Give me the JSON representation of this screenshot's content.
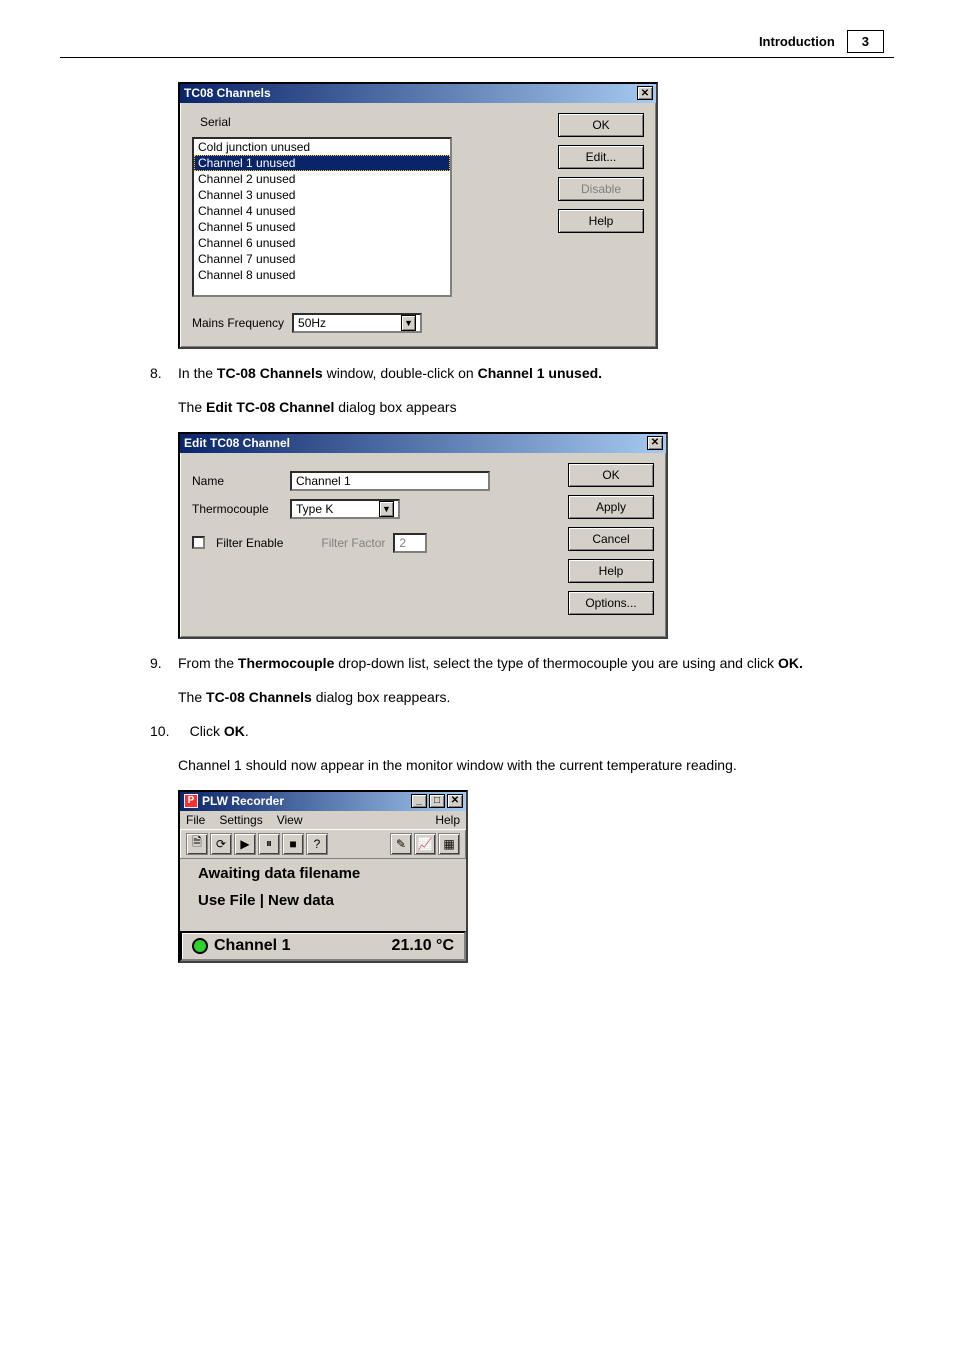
{
  "header": {
    "section": "Introduction",
    "page": "3"
  },
  "tc08": {
    "title": "TC08 Channels",
    "label_serial": "Serial",
    "items": [
      "Cold junction unused",
      "Channel 1 unused",
      "Channel 2 unused",
      "Channel 3 unused",
      "Channel 4 unused",
      "Channel 5 unused",
      "Channel 6 unused",
      "Channel 7 unused",
      "Channel 8 unused"
    ],
    "selected_index": 1,
    "mains_label": "Mains Frequency",
    "mains_value": "50Hz",
    "buttons": {
      "ok": "OK",
      "edit": "Edit...",
      "disable": "Disable",
      "help": "Help"
    }
  },
  "step8_a": "8.",
  "step8_b": "In the ",
  "step8_c": "TC-08 Channels",
  "step8_d": " window, double-click on ",
  "step8_e": "Channel 1 unused.",
  "step8_after_a": "The ",
  "step8_after_b": "Edit TC-08 Channel",
  "step8_after_c": " dialog box appears",
  "edit": {
    "title": "Edit TC08 Channel",
    "name_label": "Name",
    "name_value": "Channel 1",
    "thermo_label": "Thermocouple",
    "thermo_value": "Type K",
    "filter_enable_label": "Filter Enable",
    "filter_factor_label": "Filter Factor",
    "filter_factor_value": "2",
    "buttons": {
      "ok": "OK",
      "apply": "Apply",
      "cancel": "Cancel",
      "help": "Help",
      "options": "Options..."
    }
  },
  "step9_a": "9.",
  "step9_b": "From the ",
  "step9_c": "Thermocouple",
  "step9_d": " drop-down list, select the type of thermocouple you are using and click ",
  "step9_e": "OK.",
  "step9_after_a": "The ",
  "step9_after_b": "TC-08 Channels",
  "step9_after_c": " dialog box reappears.",
  "step10_a": "10.",
  "step10_b": "Click ",
  "step10_c": "OK",
  "step10_d": ".",
  "step10_after": "Channel 1 should now appear in the monitor window with the current temperature reading.",
  "plw": {
    "title": "PLW Recorder",
    "menu": {
      "file": "File",
      "settings": "Settings",
      "view": "View",
      "help": "Help"
    },
    "status1": "Awaiting data filename",
    "status2": "Use File | New data",
    "channel_name": "Channel 1",
    "channel_value": "21.10",
    "channel_unit": "°C",
    "led_color": "#2dd12d"
  },
  "icons": {
    "close": "✕",
    "min": "_",
    "max": "□",
    "dd": "▼",
    "qm": "?",
    "new": "🗎",
    "redo": "⟳",
    "play": "▶",
    "pause": "⏸",
    "stop": "■"
  }
}
